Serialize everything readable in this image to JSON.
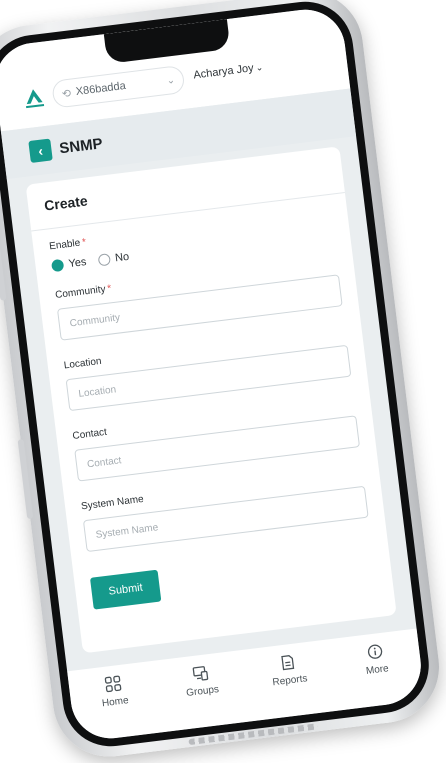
{
  "header": {
    "tenant": "X86badda",
    "user": "Acharya Joy"
  },
  "page": {
    "title": "SNMP"
  },
  "form": {
    "title": "Create",
    "enable": {
      "label": "Enable",
      "options": [
        "Yes",
        "No"
      ],
      "selected": "Yes"
    },
    "community": {
      "label": "Community",
      "placeholder": "Community",
      "value": ""
    },
    "location": {
      "label": "Location",
      "placeholder": "Location",
      "value": ""
    },
    "contact": {
      "label": "Contact",
      "placeholder": "Contact",
      "value": ""
    },
    "system_name": {
      "label": "System Name",
      "placeholder": "System Name",
      "value": ""
    },
    "submit_label": "Submit"
  },
  "nav": {
    "items": [
      {
        "label": "Home",
        "icon": "grid-icon"
      },
      {
        "label": "Groups",
        "icon": "devices-icon"
      },
      {
        "label": "Reports",
        "icon": "report-icon"
      },
      {
        "label": "More",
        "icon": "info-icon"
      }
    ]
  },
  "colors": {
    "accent": "#159a8c",
    "required": "#e05353",
    "page_bg": "#e6ebee"
  }
}
